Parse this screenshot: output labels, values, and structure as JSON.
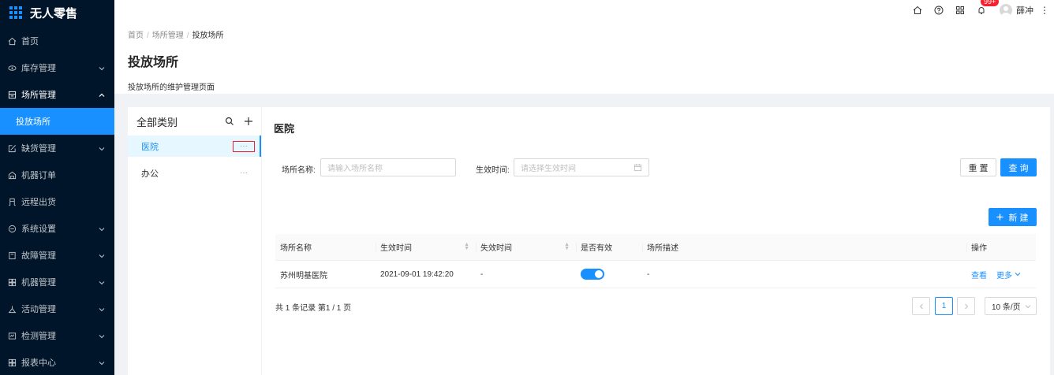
{
  "app": {
    "title": "无人零售"
  },
  "sidebar": {
    "items": [
      {
        "label": "首页",
        "icon": "home-icon",
        "arrow": ""
      },
      {
        "label": "库存管理",
        "icon": "inventory-icon",
        "arrow": "down"
      },
      {
        "label": "场所管理",
        "icon": "location-icon",
        "arrow": "up"
      },
      {
        "label": "投放场所",
        "icon": "",
        "arrow": ""
      },
      {
        "label": "缺货管理",
        "icon": "stockout-icon",
        "arrow": "down"
      },
      {
        "label": "机器订单",
        "icon": "order-icon",
        "arrow": ""
      },
      {
        "label": "远程出货",
        "icon": "remote-icon",
        "arrow": ""
      },
      {
        "label": "系统设置",
        "icon": "settings-icon",
        "arrow": "down"
      },
      {
        "label": "故障管理",
        "icon": "fault-icon",
        "arrow": "down"
      },
      {
        "label": "机器管理",
        "icon": "machine-icon",
        "arrow": "down"
      },
      {
        "label": "活动管理",
        "icon": "activity-icon",
        "arrow": "down"
      },
      {
        "label": "检测管理",
        "icon": "detect-icon",
        "arrow": "down"
      },
      {
        "label": "报表中心",
        "icon": "report-icon",
        "arrow": "down"
      }
    ]
  },
  "header": {
    "badge": "99+",
    "username": "薛冲"
  },
  "breadcrumb": {
    "items": [
      "首页",
      "场所管理",
      "投放场所"
    ]
  },
  "page": {
    "title": "投放场所",
    "description": "投放场所的维护管理页面"
  },
  "tree": {
    "title": "全部类别",
    "nodes": [
      {
        "label": "医院",
        "more": "···"
      },
      {
        "label": "办公",
        "more": "···"
      }
    ]
  },
  "main": {
    "title": "医院",
    "filters": {
      "name_label": "场所名称:",
      "name_placeholder": "请输入场所名称",
      "time_label": "生效时间:",
      "time_placeholder": "请选择生效时间"
    },
    "buttons": {
      "reset": "重 置",
      "query": "查 询",
      "create": "新 建"
    },
    "table": {
      "columns": [
        "场所名称",
        "生效时间",
        "失效时间",
        "是否有效",
        "场所描述",
        "操作"
      ],
      "rows": [
        {
          "name": "苏州明基医院",
          "start": "2021-09-01 19:42:20",
          "end": "-",
          "valid": true,
          "desc": "-",
          "action_view": "查看",
          "action_more": "更多"
        }
      ]
    },
    "pagination": {
      "info": "共 1 条记录 第1 / 1 页",
      "current": "1",
      "page_size": "10 条/页"
    }
  },
  "colors": {
    "primary": "#1890ff",
    "sidebar_bg": "#001529",
    "danger": "#f5222d"
  }
}
